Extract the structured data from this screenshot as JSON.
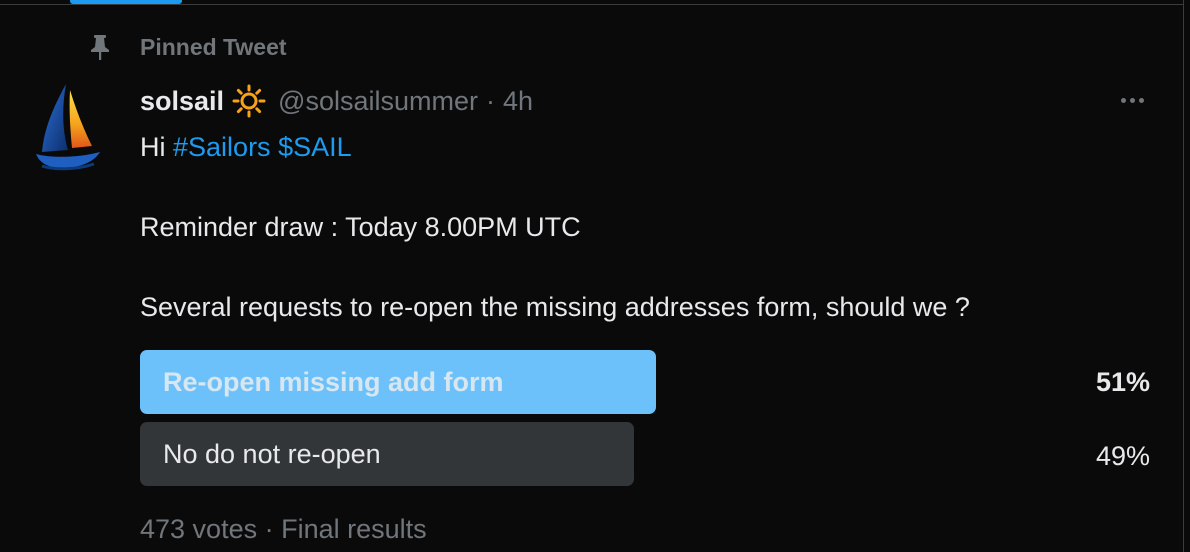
{
  "pinned": {
    "label": "Pinned Tweet"
  },
  "tweet": {
    "display_name": "solsail",
    "handle": "@solsailsummer",
    "separator": "·",
    "time": "4h",
    "greeting": "Hi",
    "hashtag": "#Sailors",
    "cashtag": "$SAIL",
    "line2": "Reminder draw : Today 8.00PM UTC",
    "line3": "Several requests to re-open the missing addresses form, should we ?"
  },
  "poll": {
    "options": [
      {
        "label": "Re-open missing add form",
        "percent": "51%",
        "share": 0.51,
        "winner": true
      },
      {
        "label": "No do not re-open",
        "percent": "49%",
        "share": 0.49,
        "winner": false
      }
    ],
    "votes": "473 votes",
    "separator": "·",
    "status": "Final results"
  },
  "icons": {
    "pin": "pin-icon",
    "sun": "sun-emoji-icon",
    "more": "more-options-icon",
    "avatar": "sailboat-avatar"
  },
  "colors": {
    "background": "#0a0a0a",
    "accent": "#1d9bf0",
    "poll_winner": "#6cc1fb",
    "poll_other": "#323639",
    "muted_text": "#71767b"
  }
}
